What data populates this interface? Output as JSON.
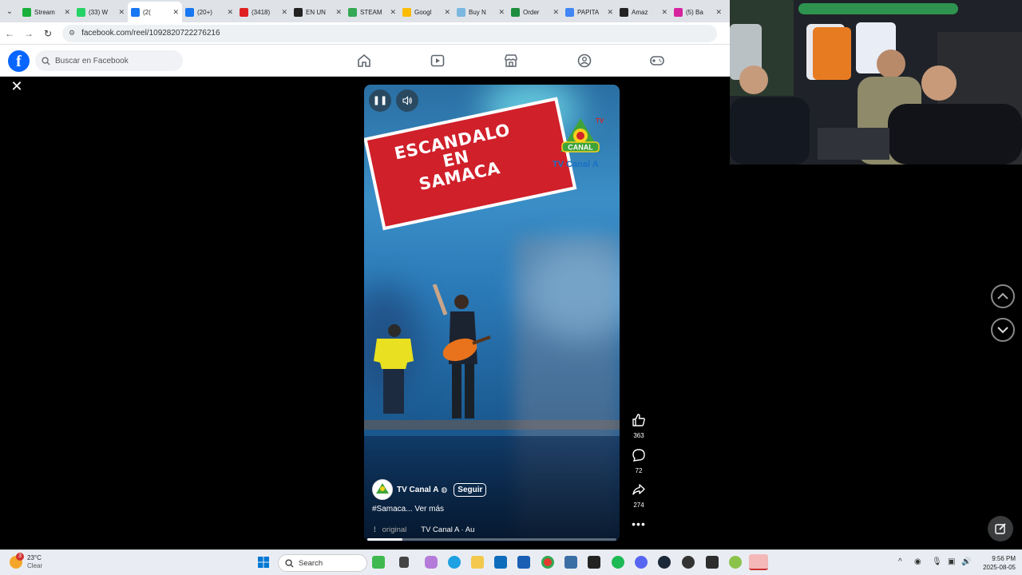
{
  "browser": {
    "tabs": [
      {
        "title": "Stream",
        "color": "#19b03c",
        "active": false
      },
      {
        "title": "(33) W",
        "color": "#25d366",
        "active": false
      },
      {
        "title": "(2(",
        "color": "#1877f2",
        "active": true
      },
      {
        "title": "(20+)",
        "color": "#1877f2",
        "active": false
      },
      {
        "title": "(3418)",
        "color": "#e02020",
        "active": false
      },
      {
        "title": "EN UN",
        "color": "#222222",
        "active": false
      },
      {
        "title": "STEAM",
        "color": "#34a853",
        "active": false
      },
      {
        "title": "Googl",
        "color": "#fbbc05",
        "active": false
      },
      {
        "title": "Buy N",
        "color": "#7bb7e0",
        "active": false
      },
      {
        "title": "Order",
        "color": "#1e8e3e",
        "active": false
      },
      {
        "title": "PAPITA",
        "color": "#4285f4",
        "active": false
      },
      {
        "title": "Amaz",
        "color": "#222222",
        "active": false
      },
      {
        "title": "(5) Ba",
        "color": "#d6249f",
        "active": false
      }
    ],
    "url": "facebook.com/reel/1092820722276216"
  },
  "facebook": {
    "logo": "f",
    "search_placeholder": "Buscar en Facebook",
    "nav_icons": [
      "home-icon",
      "video-icon",
      "marketplace-icon",
      "groups-icon",
      "gaming-icon"
    ]
  },
  "reel": {
    "banner_line1": "ESCANDALO EN",
    "banner_line2": "SAMACA",
    "logo_text": "CANAL",
    "logo_tv": "TV",
    "watermark": "TV Canal A",
    "author": "TV Canal A",
    "follow_label": "Seguir",
    "caption": "#Samaca... Ver más",
    "audio_original": "original",
    "audio_track": "TV Canal A · Au",
    "progress": 0.14,
    "likes": "363",
    "comments": "72",
    "shares": "274"
  },
  "taskbar": {
    "weather_temp": "23°C",
    "weather_desc": "Clear",
    "weather_badge": "3",
    "search_label": "Search",
    "time": "9:56 PM",
    "date": "2025-08-05"
  },
  "colors": {
    "facebook_blue": "#0866ff",
    "banner_red": "#d0202a"
  }
}
